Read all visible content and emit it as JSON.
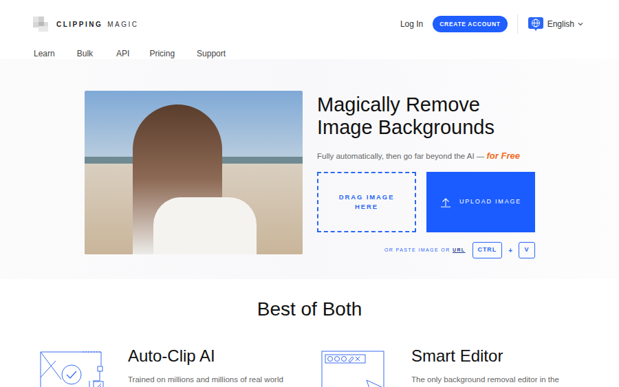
{
  "logo": {
    "bold": "CLIPPING",
    "light": "MAGIC"
  },
  "header": {
    "login": "Log In",
    "create_account": "CREATE ACCOUNT",
    "language": "English"
  },
  "nav": [
    "Learn",
    "Bulk",
    "API",
    "Pricing",
    "Support"
  ],
  "hero": {
    "title_lines": [
      "Magically Remove",
      "Image Backgrounds"
    ],
    "subtitle": "Fully automatically, then go far beyond the AI — ",
    "subtitle_emphasis": "for Free",
    "drag": "DRAG IMAGE HERE",
    "upload": "UPLOAD IMAGE",
    "paste_prefix": "OR PASTE IMAGE OR ",
    "paste_link": "URL",
    "keys": [
      "CTRL",
      "V"
    ],
    "plus": "+"
  },
  "section": {
    "title": "Best of Both"
  },
  "features": [
    {
      "title": "Auto-Clip AI",
      "text": "Trained on millions and millions of real world"
    },
    {
      "title": "Smart Editor",
      "text": "The only background removal editor in the"
    }
  ]
}
